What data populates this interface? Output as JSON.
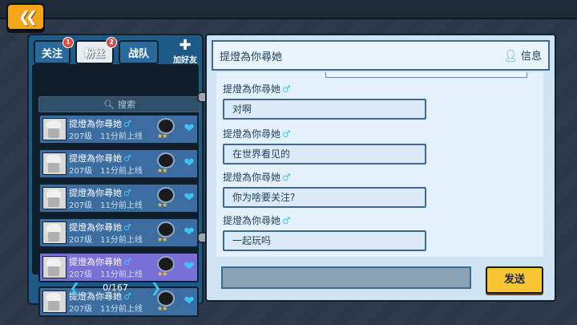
{
  "back_icon": "double-chevron-left-icon",
  "tabs": [
    {
      "label": "关注",
      "badge": "1"
    },
    {
      "label": "粉丝",
      "badge": "2"
    },
    {
      "label": "战队"
    }
  ],
  "add_friend": {
    "label": "加好友",
    "icon": "add-user-icon"
  },
  "search": {
    "placeholder": "搜索",
    "icon": "search-icon"
  },
  "friends": [
    {
      "name": "提燈為你尋她",
      "gender": "♂",
      "level": "207级",
      "status": "11分前上线"
    },
    {
      "name": "提燈為你尋她",
      "gender": "♂",
      "level": "207级",
      "status": "11分前上线"
    },
    {
      "name": "提燈為你尋她",
      "gender": "♂",
      "level": "207级",
      "status": "11分前上线"
    },
    {
      "name": "提燈為你尋她",
      "gender": "♂",
      "level": "207级",
      "status": "11分前上线"
    },
    {
      "name": "提燈為你尋她",
      "gender": "♂",
      "level": "207级",
      "status": "11分前上线"
    },
    {
      "name": "提燈為你尋她",
      "gender": "♂",
      "level": "207级",
      "status": "11分前上线"
    }
  ],
  "pager": {
    "text": "0/167"
  },
  "chat": {
    "title": "提燈為你尋她",
    "info_label": "信息",
    "messages": [
      {
        "name": "提燈為你尋她",
        "gender": "♂",
        "text": "对啊"
      },
      {
        "name": "提燈為你尋她",
        "gender": "♂",
        "text": "在世界看见的"
      },
      {
        "name": "提燈為你尋她",
        "gender": "♂",
        "text": "你为啥要关注?"
      },
      {
        "name": "提燈為你尋她",
        "gender": "♂",
        "text": "一起玩吗"
      }
    ],
    "input_value": "",
    "send_label": "发送"
  },
  "colors": {
    "accent": "#f4a51a",
    "panel": "#1e5a86",
    "selected": "#7a6fd6",
    "gender": "#3cc7ff"
  }
}
